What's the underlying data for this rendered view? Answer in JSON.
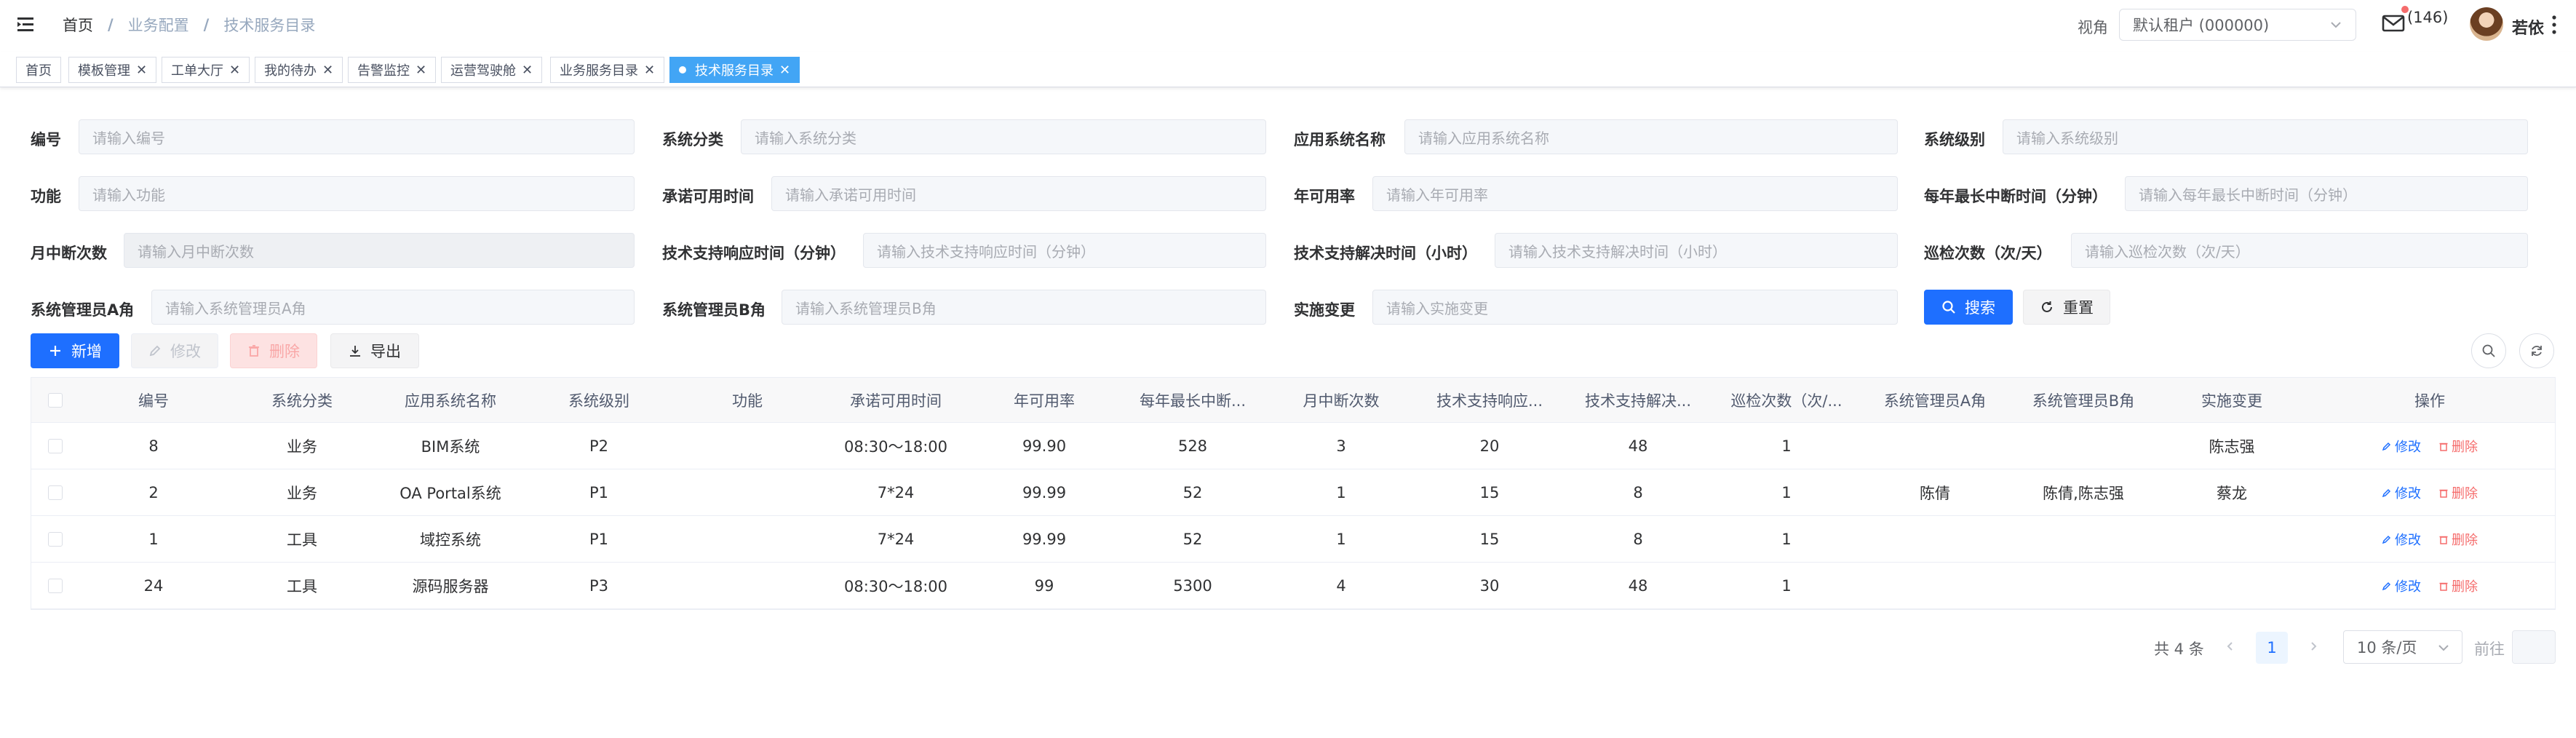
{
  "breadcrumb": [
    "首页",
    "业务配置",
    "技术服务目录"
  ],
  "header": {
    "view_label": "视角",
    "tenant": "默认租户 (000000)",
    "mail_count": "(146)",
    "username": "若依"
  },
  "tags": [
    {
      "label": "首页",
      "closable": false,
      "active": false
    },
    {
      "label": "模板管理",
      "closable": true,
      "active": false
    },
    {
      "label": "工单大厅",
      "closable": true,
      "active": false
    },
    {
      "label": "我的待办",
      "closable": true,
      "active": false
    },
    {
      "label": "告警监控",
      "closable": true,
      "active": false
    },
    {
      "label": "运营驾驶舱",
      "closable": true,
      "active": false
    },
    {
      "label": "业务服务目录",
      "closable": true,
      "active": false
    },
    {
      "label": "技术服务目录",
      "closable": true,
      "active": true
    }
  ],
  "form": {
    "fields": [
      {
        "label": "编号",
        "placeholder": "请输入编号"
      },
      {
        "label": "系统分类",
        "placeholder": "请输入系统分类"
      },
      {
        "label": "应用系统名称",
        "placeholder": "请输入应用系统名称"
      },
      {
        "label": "系统级别",
        "placeholder": "请输入系统级别"
      },
      {
        "label": "功能",
        "placeholder": "请输入功能"
      },
      {
        "label": "承诺可用时间",
        "placeholder": "请输入承诺可用时间"
      },
      {
        "label": "年可用率",
        "placeholder": "请输入年可用率"
      },
      {
        "label": "每年最长中断时间（分钟）",
        "placeholder": "请输入每年最长中断时间（分钟）"
      },
      {
        "label": "月中断次数",
        "placeholder": "请输入月中断次数"
      },
      {
        "label": "技术支持响应时间（分钟）",
        "placeholder": "请输入技术支持响应时间（分钟）"
      },
      {
        "label": "技术支持解决时间（小时）",
        "placeholder": "请输入技术支持解决时间（小时）"
      },
      {
        "label": "巡检次数（次/天）",
        "placeholder": "请输入巡检次数（次/天）"
      },
      {
        "label": "系统管理员A角",
        "placeholder": "请输入系统管理员A角"
      },
      {
        "label": "系统管理员B角",
        "placeholder": "请输入系统管理员B角"
      },
      {
        "label": "实施变更",
        "placeholder": "请输入实施变更"
      }
    ],
    "search_label": "搜索",
    "reset_label": "重置"
  },
  "toolbar": {
    "add_label": "新增",
    "edit_label": "修改",
    "delete_label": "删除",
    "export_label": "导出"
  },
  "table": {
    "columns": [
      "编号",
      "系统分类",
      "应用系统名称",
      "系统级别",
      "功能",
      "承诺可用时间",
      "年可用率",
      "每年最长中断...",
      "月中断次数",
      "技术支持响应...",
      "技术支持解决...",
      "巡检次数（次/...",
      "系统管理员A角",
      "系统管理员B角",
      "实施变更",
      "操作"
    ],
    "rows": [
      [
        "8",
        "业务",
        "BIM系统",
        "P2",
        "",
        "08:30～18:00",
        "99.90",
        "528",
        "3",
        "20",
        "48",
        "1",
        "",
        "",
        "陈志强"
      ],
      [
        "2",
        "业务",
        "OA Portal系统",
        "P1",
        "",
        "7*24",
        "99.99",
        "52",
        "1",
        "15",
        "8",
        "1",
        "陈倩",
        "陈倩,陈志强",
        "蔡龙"
      ],
      [
        "1",
        "工具",
        "域控系统",
        "P1",
        "",
        "7*24",
        "99.99",
        "52",
        "1",
        "15",
        "8",
        "1",
        "",
        "",
        ""
      ],
      [
        "24",
        "工具",
        "源码服务器",
        "P3",
        "",
        "08:30～18:00",
        "99",
        "5300",
        "4",
        "30",
        "48",
        "1",
        "",
        "",
        ""
      ]
    ],
    "row_edit_label": "修改",
    "row_delete_label": "删除"
  },
  "pagination": {
    "total": "共 4 条",
    "current_page": "1",
    "page_size": "10 条/页",
    "goto_label": "前往"
  },
  "colors": {
    "primary": "#1e6fff",
    "active_tag": "#42a5f5",
    "danger": "#f56c6c"
  }
}
